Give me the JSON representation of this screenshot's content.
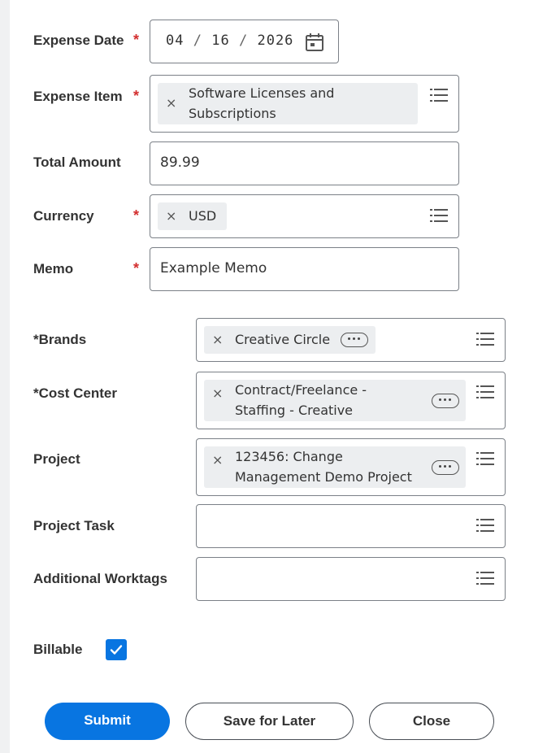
{
  "fields": {
    "expense_date": {
      "label": "Expense Date",
      "month": "04",
      "day": "16",
      "year": "2026",
      "sep": "/"
    },
    "expense_item": {
      "label": "Expense Item",
      "value_line1": "Software Licenses and",
      "value_line2": "Subscriptions"
    },
    "total_amount": {
      "label": "Total Amount",
      "value": "89.99"
    },
    "currency": {
      "label": "Currency",
      "value": "USD"
    },
    "memo": {
      "label": "Memo",
      "value": "Example Memo"
    },
    "required_mark": "*"
  },
  "worktags": {
    "brands": {
      "label": "*Brands",
      "value": "Creative Circle"
    },
    "cost_center": {
      "label": "*Cost Center",
      "value_line1": "Contract/Freelance -",
      "value_line2": "Staffing - Creative"
    },
    "project": {
      "label": "Project",
      "value_line1": "123456: Change",
      "value_line2": "Management Demo Project"
    },
    "project_task": {
      "label": "Project Task"
    },
    "additional_worktags": {
      "label": "Additional Worktags"
    }
  },
  "billable": {
    "label": "Billable",
    "checked": true
  },
  "buttons": {
    "submit": "Submit",
    "save_for_later": "Save for Later",
    "close": "Close"
  },
  "pill_remove_glyph": "×",
  "colors": {
    "primary": "#0875e1",
    "required": "#d32f2f",
    "border": "#7b8087",
    "pill_bg": "#eceef0"
  }
}
